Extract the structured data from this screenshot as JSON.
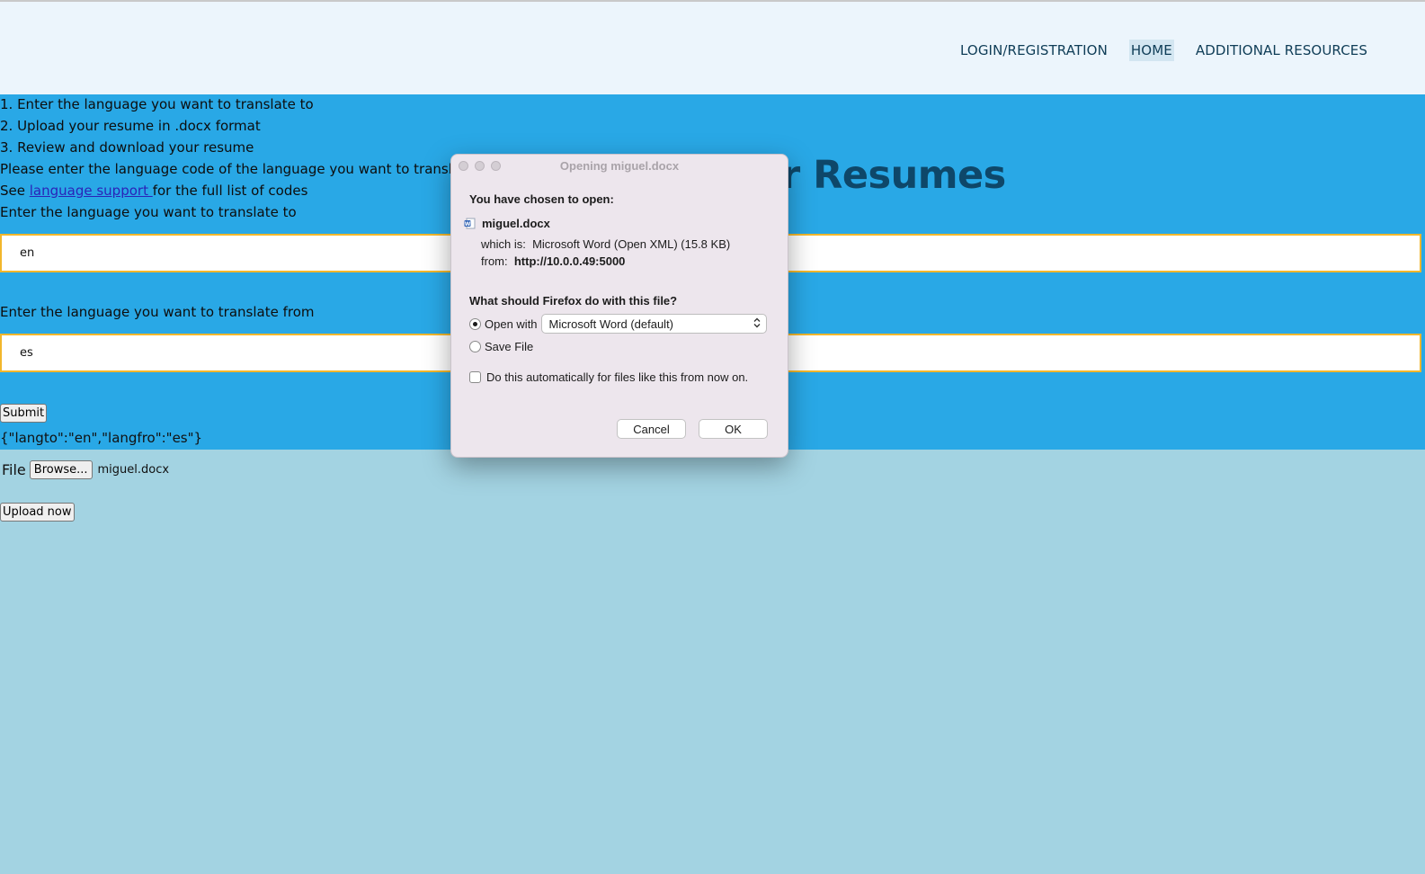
{
  "nav": {
    "items": [
      {
        "label": "LOGIN/REGISTRATION",
        "active": false
      },
      {
        "label": "HOME",
        "active": true
      },
      {
        "label": "ADDITIONAL RESOURCES",
        "active": false
      }
    ]
  },
  "instructions": {
    "step1": "1. Enter the language you want to translate to",
    "step2": "2. Upload your resume in .docx format",
    "step3": "3. Review and download your resume",
    "code_prompt": "Please enter the language code of the language you want to translate",
    "see_prefix": "See ",
    "link_text": "language support ",
    "see_suffix": "for the full list of codes"
  },
  "page_title_visible": "or Resumes",
  "form": {
    "to_label": "Enter the language you want to translate to",
    "to_value": "en",
    "from_label": "Enter the language you want to translate from",
    "from_value": "es",
    "submit_label": "Submit",
    "result_json": "{\"langto\":\"en\",\"langfro\":\"es\"}",
    "file_label": "File",
    "browse_label": "Browse...",
    "file_name": "miguel.docx",
    "upload_label": "Upload now"
  },
  "dialog": {
    "title": "Opening miguel.docx",
    "chosen_label": "You have chosen to open:",
    "file_name": "miguel.docx",
    "which_is_label": "which is:",
    "which_is_value": "Microsoft Word (Open XML) (15.8 KB)",
    "from_label": "from:",
    "from_value": "http://10.0.0.49:5000",
    "question": "What should Firefox do with this file?",
    "open_with_label": "Open with",
    "open_with_app": "Microsoft Word (default)",
    "save_file_label": "Save File",
    "auto_label": "Do this automatically for files like this from now on.",
    "cancel_label": "Cancel",
    "ok_label": "OK"
  },
  "colors": {
    "header_bg": "#ecf5fc",
    "blue_band": "#29a8e6",
    "page_bg": "#a3d3e2",
    "input_border": "#f2b72c",
    "title_color": "#0e4769"
  }
}
